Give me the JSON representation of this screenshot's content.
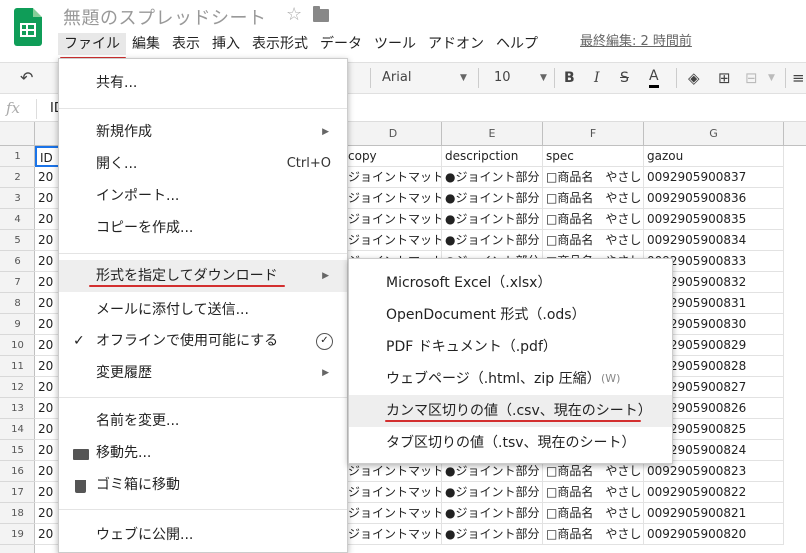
{
  "header": {
    "title": "無題のスプレッドシート",
    "star": "☆",
    "last_edit": "最終編集: 2 時間前"
  },
  "menubar": [
    "ファイル",
    "編集",
    "表示",
    "挿入",
    "表示形式",
    "データ",
    "ツール",
    "アドオン",
    "ヘルプ"
  ],
  "toolbar": {
    "font": "Arial",
    "size": "10",
    "bold": "B",
    "italic": "I",
    "strike": "S",
    "text_color": "A"
  },
  "formula_bar": {
    "fx": "fx",
    "value": "ID"
  },
  "columns": [
    "D",
    "E",
    "F",
    "G"
  ],
  "rows": [
    "1",
    "2",
    "3",
    "4",
    "5",
    "6",
    "7",
    "8",
    "9",
    "10",
    "11",
    "12",
    "13",
    "14",
    "15",
    "16",
    "17",
    "18",
    "19"
  ],
  "sheet": {
    "header_row": {
      "a": "ID",
      "d": "copy",
      "e": "descripction",
      "f": "spec",
      "g": "gazou"
    },
    "col_a": "20",
    "col_d": "ジョイントマット",
    "col_e": "●ジョイント部分",
    "col_f": "□商品名　やさし",
    "col_g": [
      "0092905900837",
      "0092905900836",
      "0092905900835",
      "0092905900834",
      "0092905900833",
      "0092905900832",
      "0092905900831",
      "0092905900830",
      "0092905900829",
      "0092905900828",
      "0092905900827",
      "0092905900826",
      "0092905900825",
      "0092905900824",
      "0092905900823",
      "0092905900822",
      "0092905900821",
      "0092905900820"
    ]
  },
  "file_menu": {
    "share": "共有...",
    "new": "新規作成",
    "open": "開く...",
    "open_shortcut": "Ctrl+O",
    "import": "インポート...",
    "copy": "コピーを作成...",
    "download": "形式を指定してダウンロード",
    "email": "メールに添付して送信...",
    "offline": "オフラインで使用可能にする",
    "history": "変更履歴",
    "rename": "名前を変更...",
    "move": "移動先...",
    "trash": "ゴミ箱に移動",
    "publish": "ウェブに公開..."
  },
  "download_menu": {
    "xlsx": "Microsoft Excel（.xlsx）",
    "ods": "OpenDocument 形式（.ods）",
    "pdf": "PDF ドキュメント（.pdf）",
    "html": "ウェブページ（.html、zip 圧縮）",
    "html_shortcut": "(W)",
    "csv": "カンマ区切りの値（.csv、現在のシート）",
    "tsv": "タブ区切りの値（.tsv、現在のシート）"
  },
  "colors": {
    "brand": "#0f9d58",
    "annotation": "#d32f2f"
  }
}
